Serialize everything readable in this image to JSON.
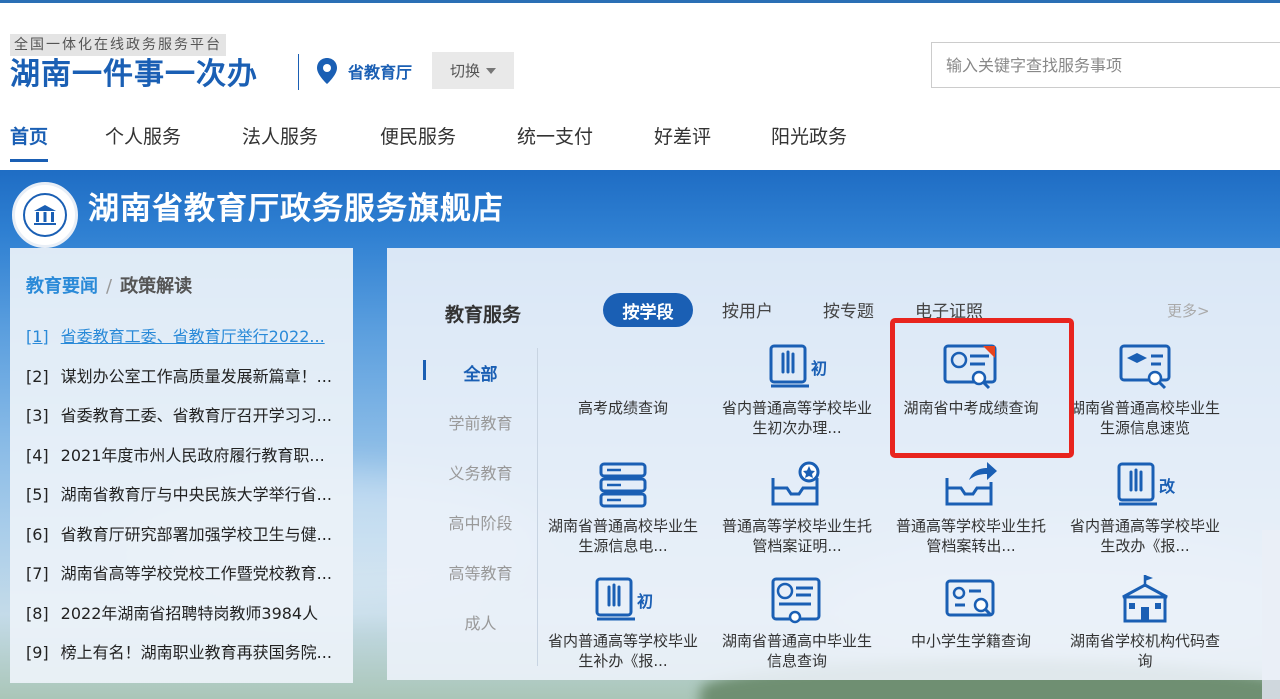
{
  "header": {
    "slogan": "全国一体化在线政务服务平台",
    "title": "湖南一件事一次办",
    "location": "省教育厅",
    "switch_label": "切换",
    "search_placeholder": "输入关键字查找服务事项"
  },
  "nav": {
    "items": [
      "首页",
      "个人服务",
      "法人服务",
      "便民服务",
      "统一支付",
      "好差评",
      "阳光政务"
    ],
    "active": "首页"
  },
  "banner": {
    "store_title": "湖南省教育厅政务服务旗舰店"
  },
  "news": {
    "tab_active": "教育要闻",
    "separator": "/",
    "tab_other": "政策解读",
    "items": [
      {
        "num": "[1]",
        "text": "省委教育工委、省教育厅举行2022..."
      },
      {
        "num": "[2]",
        "text": "谋划办公室工作高质量发展新篇章！..."
      },
      {
        "num": "[3]",
        "text": "省委教育工委、省教育厅召开学习习..."
      },
      {
        "num": "[4]",
        "text": "2021年度市州人民政府履行教育职..."
      },
      {
        "num": "[5]",
        "text": "湖南省教育厅与中央民族大学举行省..."
      },
      {
        "num": "[6]",
        "text": "省教育厅研究部署加强学校卫生与健..."
      },
      {
        "num": "[7]",
        "text": "湖南省高等学校党校工作暨党校教育..."
      },
      {
        "num": "[8]",
        "text": "2022年湖南省招聘特岗教师3984人"
      },
      {
        "num": "[9]",
        "text": "榜上有名！湖南职业教育再获国务院..."
      }
    ]
  },
  "services": {
    "heading": "教育服务",
    "tabs": [
      "按学段",
      "按用户",
      "按专题",
      "电子证照"
    ],
    "more": "更多>",
    "categories": [
      "全部",
      "学前教育",
      "义务教育",
      "高中阶段",
      "高等教育",
      "成人"
    ],
    "tiles": [
      {
        "label": "高考成绩查询",
        "icon": "score-query-icon"
      },
      {
        "label": "省内普通高等学校毕业生初次办理...",
        "icon": "hand-first-icon"
      },
      {
        "label": "湖南省中考成绩查询",
        "icon": "exam-score-search-icon"
      },
      {
        "label": "湖南省普通高校毕业生生源信息速览",
        "icon": "graduate-cert-icon"
      },
      {
        "label": "湖南省普通高校毕业生生源信息电...",
        "icon": "books-icon"
      },
      {
        "label": "普通高等学校毕业生托管档案证明...",
        "icon": "tray-star-icon"
      },
      {
        "label": "普通高等学校毕业生托管档案转出...",
        "icon": "tray-forward-icon"
      },
      {
        "label": "省内普通高等学校毕业生改办《报...",
        "icon": "hand-change-icon"
      },
      {
        "label": "省内普通高等学校毕业生补办《报...",
        "icon": "hand-first-icon"
      },
      {
        "label": "湖南省普通高中毕业生信息查询",
        "icon": "high-school-cert-icon"
      },
      {
        "label": "中小学生学籍查询",
        "icon": "student-id-search-icon"
      },
      {
        "label": "湖南省学校机构代码查询",
        "icon": "school-building-icon"
      }
    ]
  },
  "colors": {
    "brand": "#1a5fb4",
    "highlight": "#e8241e"
  }
}
